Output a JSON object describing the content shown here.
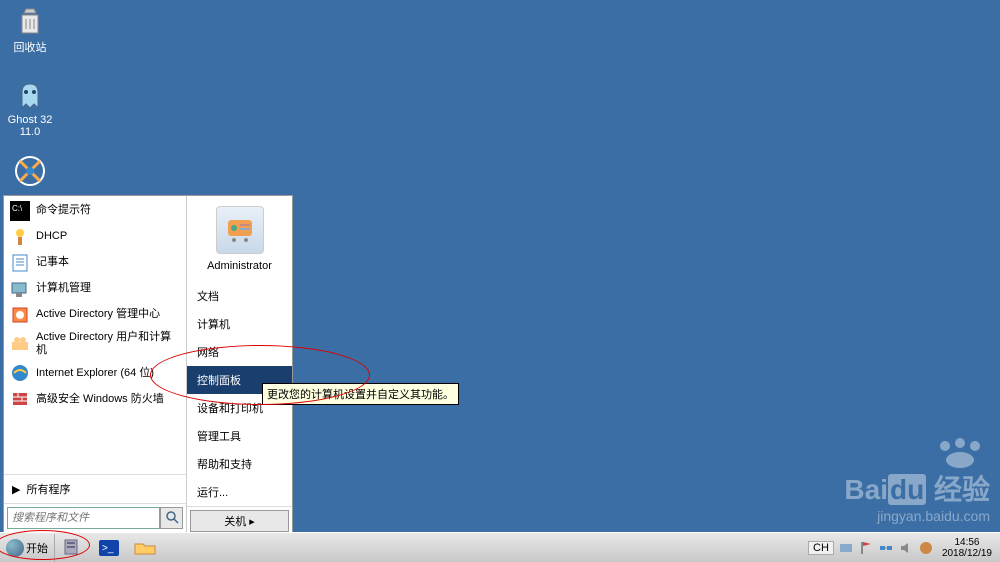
{
  "desktop": {
    "recycle_bin": "回收站",
    "ghost": "Ghost 32 11.0",
    "my_computer": ""
  },
  "start_menu": {
    "programs": [
      {
        "label": "命令提示符",
        "icon": "cmd"
      },
      {
        "label": "DHCP",
        "icon": "dhcp"
      },
      {
        "label": "记事本",
        "icon": "notepad"
      },
      {
        "label": "计算机管理",
        "icon": "compmgmt"
      },
      {
        "label": "Active Directory 管理中心",
        "icon": "ad"
      },
      {
        "label": "Active Directory 用户和计算机",
        "icon": "adusers"
      },
      {
        "label": "Internet Explorer (64 位)",
        "icon": "ie"
      },
      {
        "label": "高级安全 Windows 防火墙",
        "icon": "firewall"
      }
    ],
    "all_programs": "所有程序",
    "search_placeholder": "搜索程序和文件",
    "user": "Administrator",
    "right_items": [
      "文档",
      "计算机",
      "网络",
      "控制面板",
      "设备和打印机",
      "管理工具",
      "帮助和支持",
      "运行..."
    ],
    "selected_index": 3,
    "shutdown": "关机"
  },
  "tooltip": "更改您的计算机设置并自定义其功能。",
  "taskbar": {
    "start": "开始",
    "lang": "CH",
    "time": "14:56",
    "date": "2018/12/19"
  },
  "watermark": {
    "brand": "Baiの经验",
    "url": "jingyan.baidu.com"
  }
}
